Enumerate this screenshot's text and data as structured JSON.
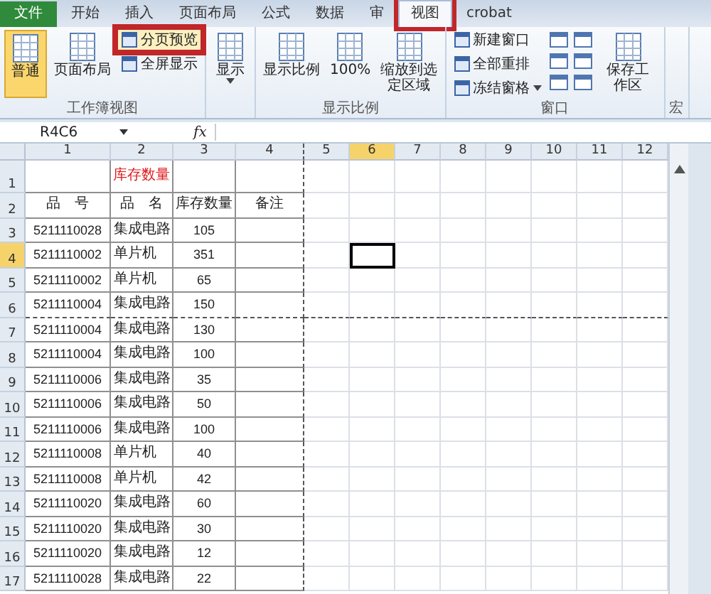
{
  "tabs": [
    {
      "label": "文件",
      "kind": "file",
      "selected": false,
      "annotated": false
    },
    {
      "label": "开始",
      "kind": "tab",
      "selected": false,
      "annotated": false
    },
    {
      "label": "插入",
      "kind": "tab",
      "selected": false,
      "annotated": false
    },
    {
      "label": "页面布局",
      "kind": "tab",
      "selected": false,
      "annotated": false
    },
    {
      "label": "公式",
      "kind": "tab",
      "selected": false,
      "annotated": false
    },
    {
      "label": "数据",
      "kind": "tab",
      "selected": false,
      "annotated": false
    },
    {
      "label": "审",
      "kind": "tab",
      "selected": false,
      "annotated": false
    },
    {
      "label": "视图",
      "kind": "tab",
      "selected": true,
      "annotated": true
    },
    {
      "label": "crobat",
      "kind": "tab",
      "selected": false,
      "annotated": false
    }
  ],
  "ribbon": [
    {
      "label": "工作簿视图",
      "items": [
        {
          "kind": "large",
          "label": "普通",
          "selected": true,
          "annotated": false
        },
        {
          "kind": "large",
          "label": "页面布局",
          "selected": false,
          "annotated": false
        },
        {
          "kind": "small",
          "label": "分页预览",
          "selected": false,
          "annotated": true
        },
        {
          "kind": "small",
          "label": "全屏显示",
          "selected": false,
          "annotated": false
        }
      ]
    },
    {
      "items": [
        {
          "kind": "dropdown",
          "label": "显示",
          "selected": false,
          "annotated": false
        }
      ]
    },
    {
      "label": "显示比例",
      "items": [
        {
          "kind": "large",
          "label": "显示比例",
          "selected": false,
          "annotated": false
        },
        {
          "kind": "large",
          "label": "100%",
          "selected": false,
          "annotated": false
        },
        {
          "kind": "large",
          "label": "缩放到选定区域",
          "selected": false,
          "annotated": false
        }
      ]
    },
    {
      "label": "窗口",
      "items": [
        {
          "kind": "small",
          "label": "新建窗口",
          "selected": false,
          "annotated": false
        },
        {
          "kind": "small",
          "label": "全部重排",
          "selected": false,
          "annotated": false
        },
        {
          "kind": "small-dropdown",
          "label": "冻结窗格",
          "selected": false,
          "annotated": false
        },
        {
          "kind": "icons"
        },
        {
          "kind": "icons"
        },
        {
          "kind": "large",
          "label": "保存工作区",
          "selected": false,
          "annotated": false
        }
      ]
    },
    {
      "label": "宏"
    }
  ],
  "formula_bar": {
    "name_box": "R4C6",
    "function_label": "fx"
  },
  "sheet": {
    "columns": [
      {
        "label": "1",
        "selected": false,
        "page_break": false
      },
      {
        "label": "2",
        "selected": false,
        "page_break": false
      },
      {
        "label": "3",
        "selected": false,
        "page_break": false
      },
      {
        "label": "4",
        "selected": false,
        "page_break": true
      },
      {
        "label": "5",
        "selected": false,
        "page_break": false
      },
      {
        "label": "6",
        "selected": true,
        "page_break": false
      },
      {
        "label": "7",
        "selected": false,
        "page_break": false
      },
      {
        "label": "8",
        "selected": false,
        "page_break": false
      },
      {
        "label": "9",
        "selected": false,
        "page_break": false
      },
      {
        "label": "10",
        "selected": false,
        "page_break": false
      },
      {
        "label": "11",
        "selected": false,
        "page_break": false
      },
      {
        "label": "12",
        "selected": false,
        "page_break": false
      }
    ],
    "rows": [
      {
        "number": "1",
        "kind": "title",
        "selected": false,
        "page_break": false,
        "cells": [
          "",
          "库存数量"
        ]
      },
      {
        "number": "2",
        "kind": "header",
        "selected": false,
        "page_break": false,
        "cells": [
          "品　号",
          "品　名",
          "库存数量",
          "备注"
        ]
      },
      {
        "number": "3",
        "kind": "data",
        "selected": false,
        "page_break": false,
        "cells": [
          "5211110028",
          "集成电路",
          "105"
        ]
      },
      {
        "number": "4",
        "kind": "data",
        "selected": true,
        "page_break": false,
        "cells": [
          "5211110002",
          "单片机",
          "351"
        ]
      },
      {
        "number": "5",
        "kind": "data",
        "selected": false,
        "page_break": false,
        "cells": [
          "5211110002",
          "单片机",
          "65"
        ]
      },
      {
        "number": "6",
        "kind": "data",
        "selected": false,
        "page_break": true,
        "cells": [
          "5211110004",
          "集成电路",
          "150"
        ]
      },
      {
        "number": "7",
        "kind": "data",
        "selected": false,
        "page_break": false,
        "cells": [
          "5211110004",
          "集成电路",
          "130"
        ]
      },
      {
        "number": "8",
        "kind": "data",
        "selected": false,
        "page_break": false,
        "cells": [
          "5211110004",
          "集成电路",
          "100"
        ]
      },
      {
        "number": "9",
        "kind": "data",
        "selected": false,
        "page_break": false,
        "cells": [
          "5211110006",
          "集成电路",
          "35"
        ]
      },
      {
        "number": "10",
        "kind": "data",
        "selected": false,
        "page_break": false,
        "cells": [
          "5211110006",
          "集成电路",
          "50"
        ]
      },
      {
        "number": "11",
        "kind": "data",
        "selected": false,
        "page_break": false,
        "cells": [
          "5211110006",
          "集成电路",
          "100"
        ]
      },
      {
        "number": "12",
        "kind": "data",
        "selected": false,
        "page_break": false,
        "cells": [
          "5211110008",
          "单片机",
          "40"
        ]
      },
      {
        "number": "13",
        "kind": "data",
        "selected": false,
        "page_break": false,
        "cells": [
          "5211110008",
          "单片机",
          "42"
        ]
      },
      {
        "number": "14",
        "kind": "data",
        "selected": false,
        "page_break": false,
        "cells": [
          "5211110020",
          "集成电路",
          "60"
        ]
      },
      {
        "number": "15",
        "kind": "data",
        "selected": false,
        "page_break": false,
        "cells": [
          "5211110020",
          "集成电路",
          "30"
        ]
      },
      {
        "number": "16",
        "kind": "data",
        "selected": false,
        "page_break": false,
        "cells": [
          "5211110020",
          "集成电路",
          "12"
        ]
      },
      {
        "number": "17",
        "kind": "data",
        "selected": false,
        "page_break": false,
        "cells": [
          "5211110028",
          "集成电路",
          "22"
        ]
      }
    ]
  }
}
